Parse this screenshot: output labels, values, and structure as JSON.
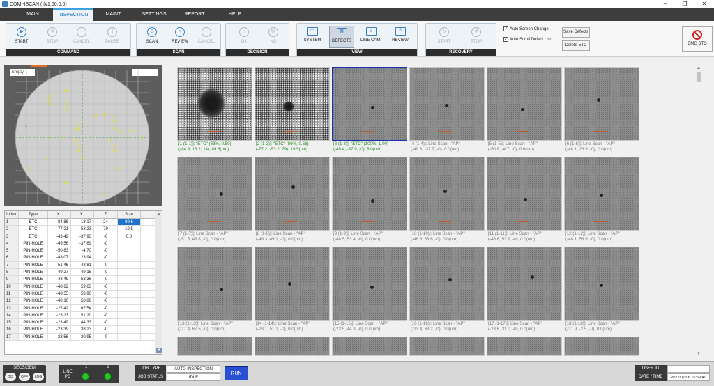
{
  "window": {
    "title": "COMI-ISCAN ( (v1.60.0.0)",
    "min": "–",
    "max": "❐",
    "close": "✕"
  },
  "tabs": [
    {
      "label": "MAIN"
    },
    {
      "label": "INSPECTION"
    },
    {
      "label": "MAINT."
    },
    {
      "label": "SETTINGS"
    },
    {
      "label": "REPORT"
    },
    {
      "label": "HELP"
    }
  ],
  "groups": {
    "command": "COMMAND",
    "scan": "SCAN",
    "decision": "DECISION",
    "view": "VIEW",
    "recovery": "RECOVERY"
  },
  "buttons": {
    "start": "START",
    "stop": "STOP",
    "cancel": "CANCEL",
    "pause": "PAUSE",
    "scan": "SCAN",
    "review": "REVIEW",
    "scan_cancel": "CANCEL",
    "ok": "OK",
    "ng": "NG",
    "system": "SYSTEM",
    "defects": "DEFECTS",
    "line_cam": "LINE CAM.",
    "view_review": "REVIEW",
    "rec_start": "START",
    "rec_stop": "STOP",
    "save_defects": "Save Defects",
    "delete_etc": "Delete ETC",
    "emg_stop": "EMG STO"
  },
  "checkboxes": {
    "auto_screen": "Auto Screen Change",
    "auto_scroll": "Auto Scroll Defect List"
  },
  "wafer": {
    "left_label": "Empty",
    "right_label": "-"
  },
  "table": {
    "headers": [
      "Index",
      "Type",
      "X",
      "Y",
      "Z",
      "Size"
    ],
    "rows": [
      [
        "1",
        "ETC",
        "-84.86",
        "13.17",
        "24",
        "89.6"
      ],
      [
        "2",
        "ETC",
        "-77.21",
        "-53.23",
        "79",
        "19.5"
      ],
      [
        "3",
        "ETC",
        "-49.42",
        "-37.93",
        "-0",
        "6.0"
      ],
      [
        "4",
        "PIN-HOLE",
        "-49.56",
        "-37.69",
        "-0",
        ""
      ],
      [
        "5",
        "PIN-HOLE",
        "-50.83",
        "-4.70",
        "-0",
        ""
      ],
      [
        "6",
        "PIN-HOLE",
        "-48.07",
        "23.94",
        "-0",
        ""
      ],
      [
        "7",
        "PIN-HOLE",
        "-51.46",
        "48.81",
        "-0",
        ""
      ],
      [
        "8",
        "PIN-HOLE",
        "-49.27",
        "49.15",
        "-0",
        ""
      ],
      [
        "9",
        "PIN-HOLE",
        "-48.49",
        "53.36",
        "-0",
        ""
      ],
      [
        "10",
        "PIN-HOLE",
        "-48.62",
        "53.63",
        "-0",
        ""
      ],
      [
        "11",
        "PIN-HOLE",
        "-48.55",
        "53.90",
        "-0",
        ""
      ],
      [
        "12",
        "PIN-HOLE",
        "-48.10",
        "58.88",
        "-0",
        ""
      ],
      [
        "13",
        "PIN-HOLE",
        "-27.42",
        "67.54",
        "-0",
        ""
      ],
      [
        "14",
        "PIN-HOLE",
        "-23.13",
        "51.20",
        "-0",
        ""
      ],
      [
        "15",
        "PIN-HOLE",
        "-23.49",
        "44.33",
        "-0",
        ""
      ],
      [
        "16",
        "PIN-HOLE",
        "-23.39",
        "38.23",
        "-0",
        ""
      ],
      [
        "17",
        "PIN-HOLE",
        "-23.56",
        "30.95",
        "-0",
        ""
      ]
    ]
  },
  "thumbs": [
    {
      "l1": "[1 (1-1)]: \"ETC\" (83%, 0.59)",
      "l2": "(-84.9, 13.2, 24), 89.6(um)",
      "green": true
    },
    {
      "l1": "[2 (1-2)]: \"ETC\" (86%, 0.66)",
      "l2": "(-77.2, -53.2, 79), 19.5(um)",
      "green": true
    },
    {
      "l1": "[3 (1-3)]: \"ETC\" (100%, 1.00)",
      "l2": "(-49.4, -37.9, -0), 6.0(um)",
      "green": true
    },
    {
      "l1": "[4 (1-4)]: Line Scan - \"AP\"",
      "l2": "(-49.6, -37.7, -0), 0.0(um)"
    },
    {
      "l1": "[5 (1-5)]: Line Scan - \"AP\"",
      "l2": "(-50.8, -4.7, -0), 0.0(um)"
    },
    {
      "l1": "[6 (1-6)]: Line Scan - \"AP\"",
      "l2": "(-48.1, 23.9, -0), 0.0(um)"
    },
    {
      "l1": "[7 (1-7)]: Line Scan - \"AP\"",
      "l2": "(-51.5, 48.8, -0), 0.0(um)"
    },
    {
      "l1": "[8 (1-8)]: Line Scan - \"AP\"",
      "l2": "(-49.3, 49.1, -0), 0.0(um)"
    },
    {
      "l1": "[9 (1-9)]: Line Scan - \"AP\"",
      "l2": "(-48.5, 53.4, -0), 0.0(um)"
    },
    {
      "l1": "[10 (1-10)]: Line Scan - \"AP\"",
      "l2": "(-48.6, 53.6, -0), 0.0(um)"
    },
    {
      "l1": "[11 (1-11)]: Line Scan - \"AP\"",
      "l2": "(-48.6, 53.9, -0), 0.0(um)"
    },
    {
      "l1": "[12 (1-12)]: Line Scan - \"AP\"",
      "l2": "(-48.1, 58.9, -0), 0.0(um)"
    },
    {
      "l1": "[13 (1-13)]: Line Scan - \"AP\"",
      "l2": "(-27.4, 67.5, -0), 0.0(um)"
    },
    {
      "l1": "[14 (1-14)]: Line Scan - \"AP\"",
      "l2": "(-23.1, 51.2, -0), 0.0(um)"
    },
    {
      "l1": "[15 (1-15)]: Line Scan - \"AP\"",
      "l2": "(-23.5, 44.3, -0), 0.0(um)"
    },
    {
      "l1": "[16 (1-16)]: Line Scan - \"AP\"",
      "l2": "(-23.4, 38.2, -0), 0.0(um)"
    },
    {
      "l1": "[17 (1-17)]: Line Scan - \"AP\"",
      "l2": "(-23.6, 31.0, -0), 0.0(um)"
    },
    {
      "l1": "[18 (1-18)]: Line Scan - \"AP\"",
      "l2": "(-31.9, -2.5, -0), 0.0(um)"
    }
  ],
  "status": {
    "secs_label": "SECS/GEM",
    "dis": "DIS",
    "off": "OFF",
    "log": "LOG",
    "line_pc": "LINE PC",
    "pc1": "1",
    "pc2": "2",
    "job_type_label": "JOB TYPE",
    "job_type": "AUTO INSPECTION",
    "job_status_label": "JOB STATUS",
    "job_status": "IDLE",
    "run": "RUN",
    "user_id_label": "USER ID",
    "user_id": "",
    "datetime_label": "DATE / TIME",
    "datetime": "2022/07/06 15:59:40"
  }
}
